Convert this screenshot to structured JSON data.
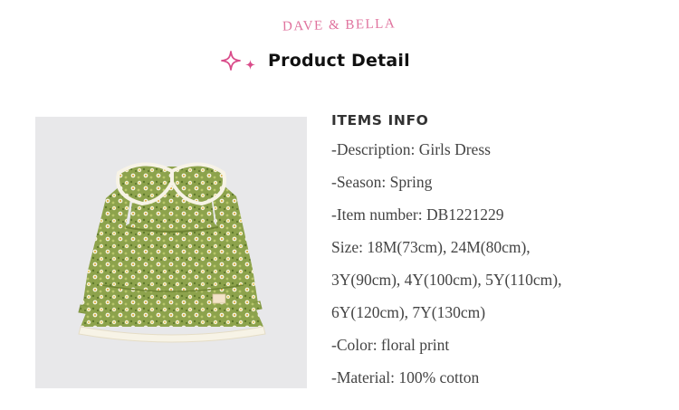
{
  "header": {
    "brand": "DAVE & BELLA",
    "title": "Product Detail"
  },
  "product_image": {
    "description_icon": "floral-dress-photo"
  },
  "info": {
    "heading": "ITEMS INFO",
    "lines": [
      "-Description: Girls Dress",
      "-Season: Spring",
      "-Item number: DB1221229",
      "Size: 18M(73cm), 24M(80cm),",
      "3Y(90cm), 4Y(100cm), 5Y(110cm),",
      "6Y(120cm), 7Y(130cm)",
      "-Color: floral print",
      "-Material: 100% cotton"
    ]
  },
  "colors": {
    "brand_pink": "#e0739e",
    "sparkle_pink": "#d94c8a",
    "dress_green": "#93a852"
  }
}
